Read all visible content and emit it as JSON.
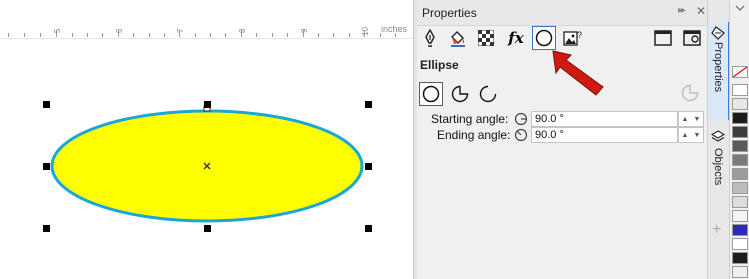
{
  "ruler": {
    "unit": "inches",
    "numbers": [
      "5",
      "6",
      "7",
      "8",
      "9",
      "10"
    ]
  },
  "docker": {
    "title": "Properties",
    "section_title": "Ellipse",
    "fields": {
      "starting_angle": {
        "label": "Starting angle:",
        "value": "90.0 °"
      },
      "ending_angle": {
        "label": "Ending angle:",
        "value": "90.0 °"
      }
    }
  },
  "side_tabs": {
    "properties": "Properties",
    "objects": "Objects"
  },
  "colors": {
    "ellipse_fill": "#ffff00",
    "ellipse_outline": "#1aa7d6",
    "accent": "#3a77c8",
    "arrow": "#d0190f"
  },
  "icons": {
    "toolbar": [
      "outline-pen-icon",
      "fill-bucket-icon",
      "transparency-icon",
      "fx-effects-icon",
      "ellipse-icon",
      "summary-image-icon",
      "frame-icon",
      "toggle-icon"
    ],
    "ellipse_types": [
      "ellipse-icon",
      "pie-icon",
      "arc-icon"
    ]
  },
  "palette": [
    "#ffffff",
    "#e8e8e8",
    "#1b1b1b",
    "#3c3c3c",
    "#5a5a5a",
    "#7a7a7a",
    "#9b9b9b",
    "#bcbcbc",
    "#dcdcdc",
    "#f4f4f4",
    "#2b2bb8",
    "#ffffff",
    "#1c1c1c"
  ]
}
